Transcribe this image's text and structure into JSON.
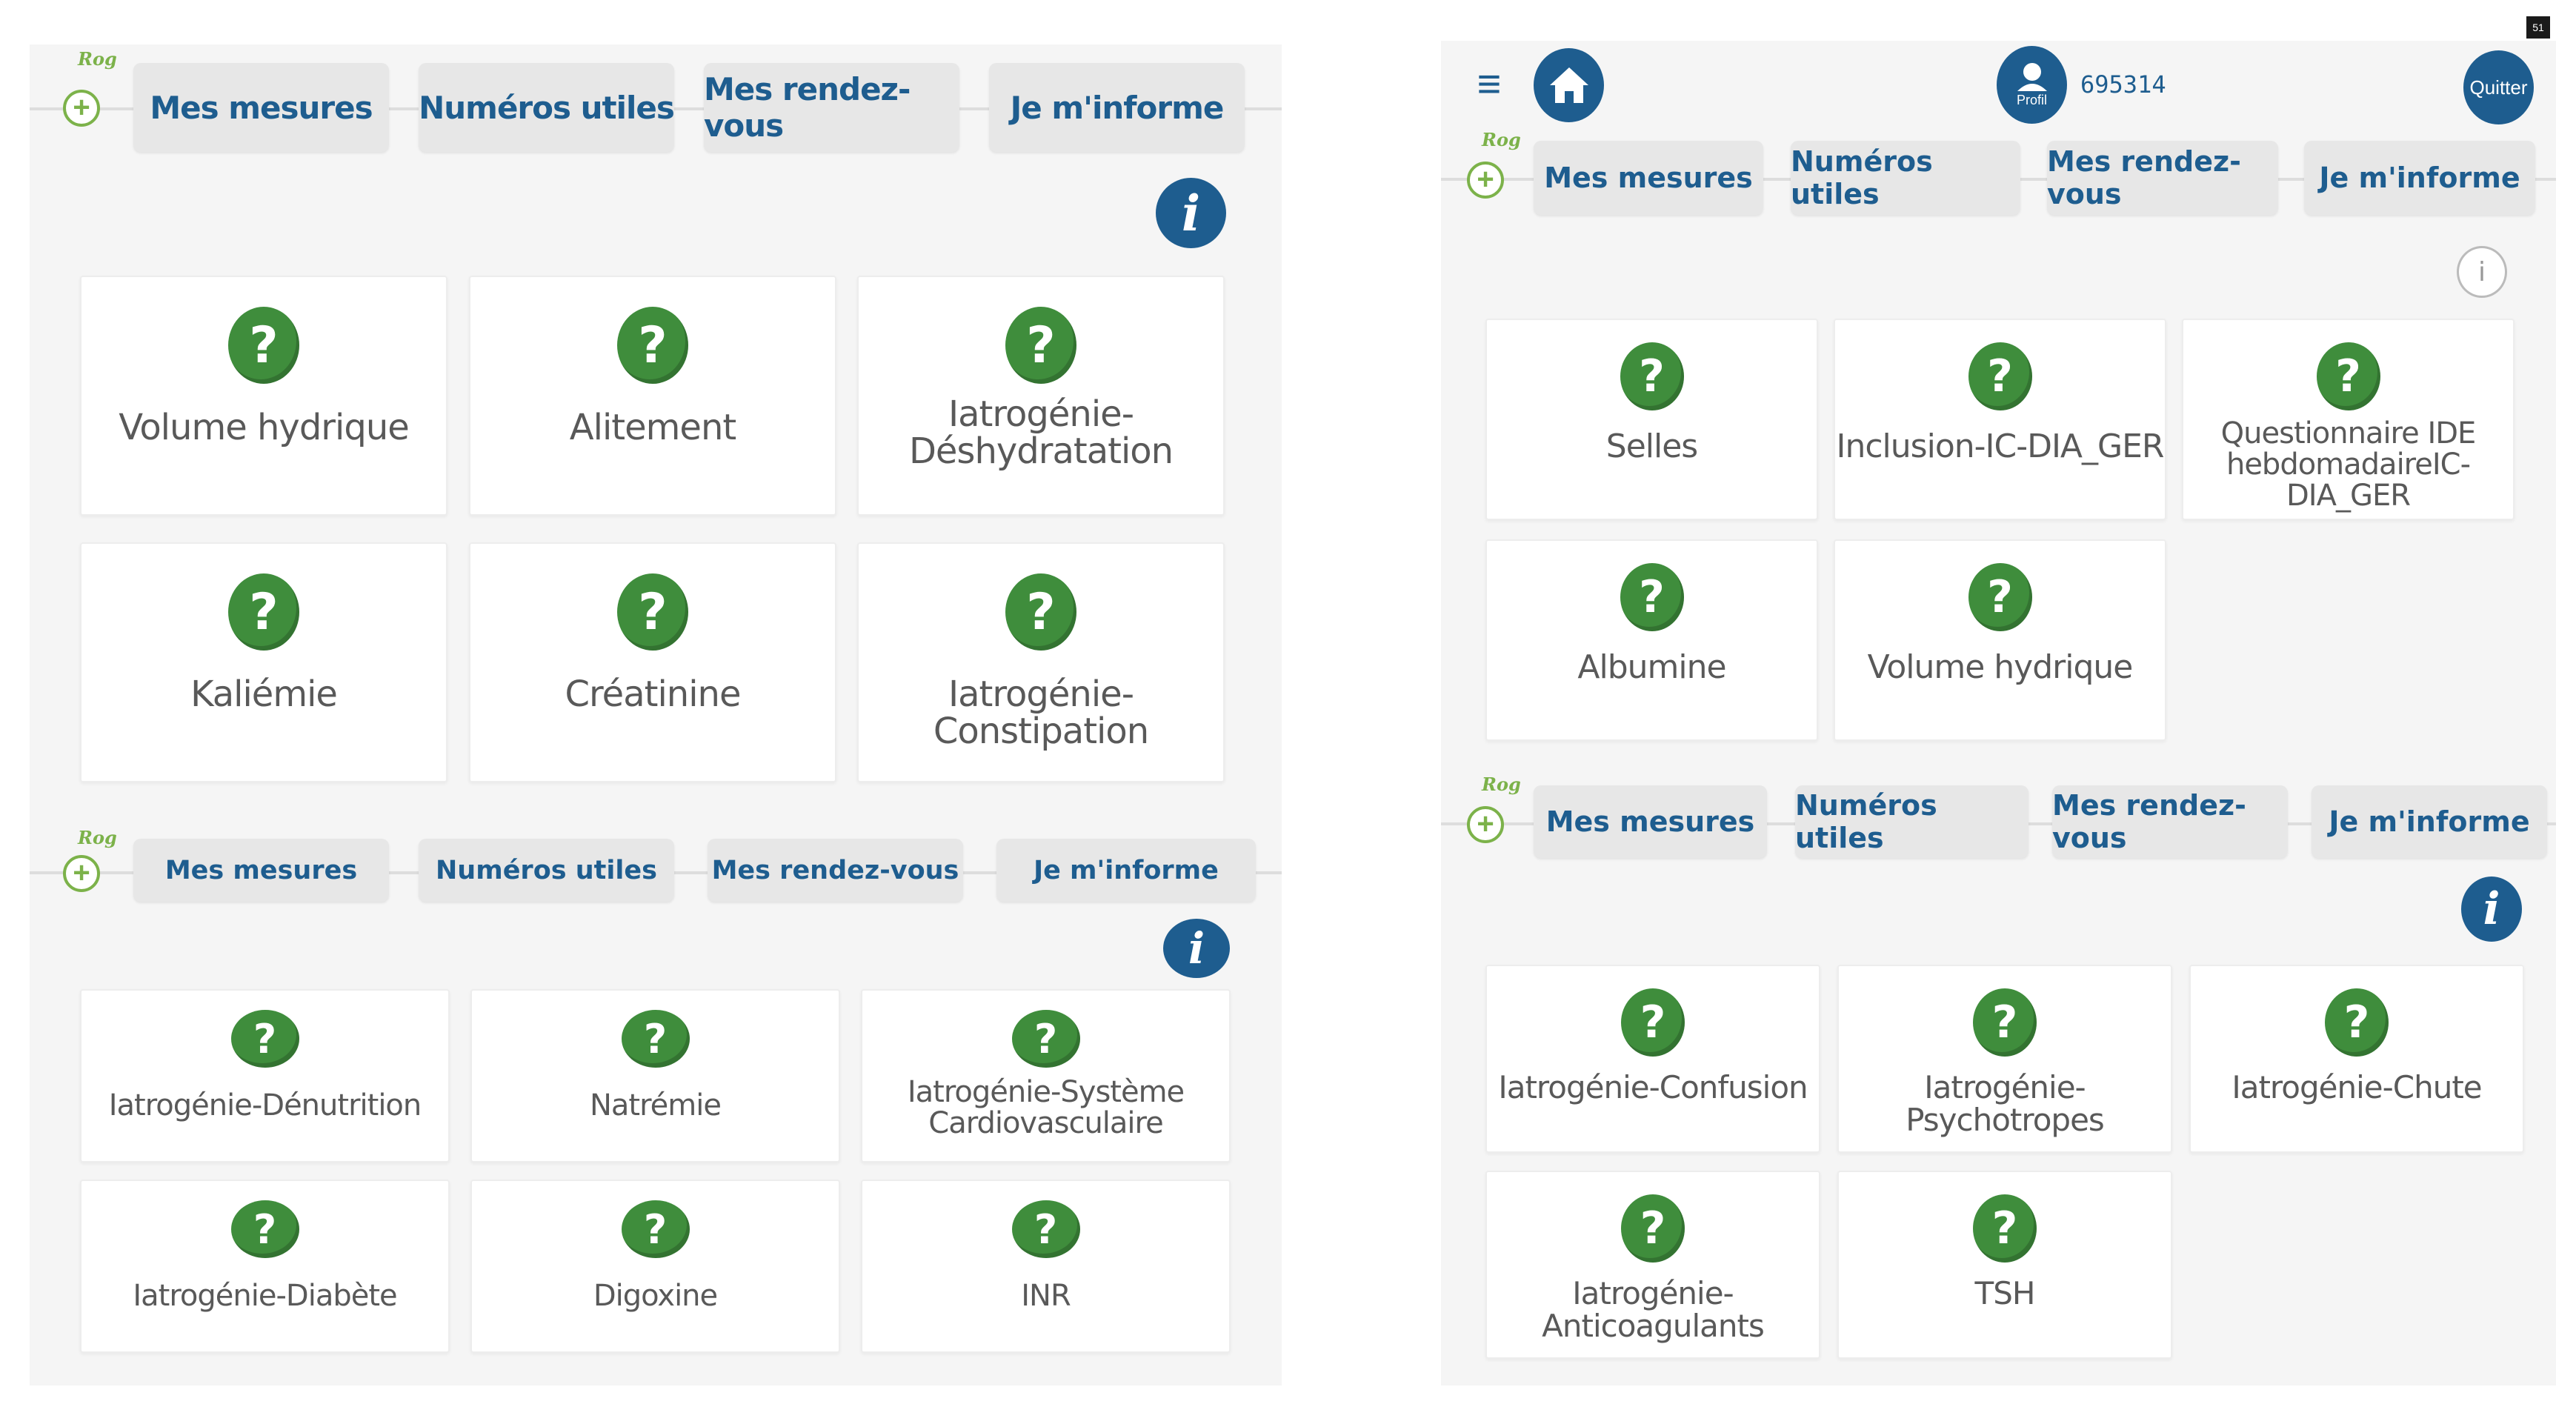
{
  "nav": {
    "measures": "Mes mesures",
    "numbers": "Numéros utiles",
    "appointments": "Mes rendez-vous",
    "inform": "Je m'informe"
  },
  "flag_text": "Rog",
  "header": {
    "profile_label": "Profil",
    "patient_id": "695314",
    "quit_label": "Quitter",
    "corner_badge": "51"
  },
  "screens": {
    "top_left": [
      "Volume hydrique",
      "Alitement",
      "Iatrogénie-\nDéshydratation",
      "Kaliémie",
      "Créatinine",
      "Iatrogénie-Constipation"
    ],
    "bottom_left": [
      "Iatrogénie-Dénutrition",
      "Natrémie",
      "Iatrogénie-Système\nCardiovasculaire",
      "Iatrogénie-Diabète",
      "Digoxine",
      "INR"
    ],
    "top_right": [
      "Selles",
      "Inclusion-IC-DIA_GER",
      "Questionnaire IDE\nhebdomadaireIC-DIA_GER",
      "Albumine",
      "Volume hydrique"
    ],
    "bottom_right": [
      "Iatrogénie-Confusion",
      "Iatrogénie-Psychotropes",
      "Iatrogénie-Chute",
      "Iatrogénie-Anticoagulants",
      "TSH"
    ]
  },
  "icons": {
    "question": "?",
    "info": "i",
    "plus": "+",
    "menu": "≡"
  },
  "colors": {
    "primary_blue": "#1e5d8f",
    "question_green": "#3f8d3c",
    "flag_green": "#7cb24a",
    "nav_bg": "#e7e7e7"
  }
}
